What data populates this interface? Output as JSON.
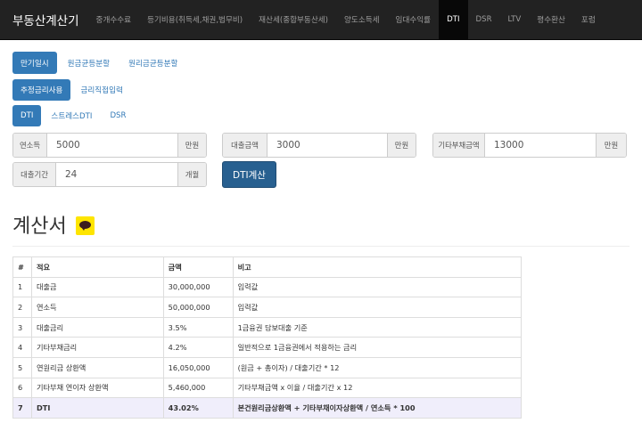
{
  "navbar": {
    "brand": "부동산계산기",
    "items": [
      {
        "label": "중개수수료",
        "active": false
      },
      {
        "label": "등기비용(취득세,채권,법무비)",
        "active": false
      },
      {
        "label": "재산세(종합부동산세)",
        "active": false
      },
      {
        "label": "양도소득세",
        "active": false
      },
      {
        "label": "임대수익률",
        "active": false
      },
      {
        "label": "DTI",
        "active": true
      },
      {
        "label": "DSR",
        "active": false
      },
      {
        "label": "LTV",
        "active": false
      },
      {
        "label": "평수환산",
        "active": false
      },
      {
        "label": "포럼",
        "active": false
      }
    ]
  },
  "repayment_tabs": [
    "만기일시",
    "원금균등분할",
    "원리금균등분할"
  ],
  "rate_tabs": [
    "추정금리사용",
    "금리직접입력"
  ],
  "dti_tabs": [
    "DTI",
    "스트레스DTI",
    "DSR"
  ],
  "form": {
    "annual_income": {
      "label": "연소득",
      "value": "5000",
      "unit": "만원"
    },
    "loan_amount": {
      "label": "대출금액",
      "value": "3000",
      "unit": "만원"
    },
    "other_debt": {
      "label": "기타부채금액",
      "value": "13000",
      "unit": "만원"
    },
    "loan_period": {
      "label": "대출기간",
      "value": "24",
      "unit": "개월"
    },
    "calculate_label": "DTI계산"
  },
  "statement_title": "계산서",
  "table": {
    "headers": [
      "#",
      "적요",
      "금액",
      "비고"
    ],
    "rows": [
      [
        "1",
        "대출금",
        "30,000,000",
        "입력값"
      ],
      [
        "2",
        "연소득",
        "50,000,000",
        "입력값"
      ],
      [
        "3",
        "대출금리",
        "3.5%",
        "1금융권 담보대출 기준"
      ],
      [
        "4",
        "기타부채금리",
        "4.2%",
        "일반적으로 1금융권에서 적용하는 금리"
      ],
      [
        "5",
        "연원리금 상환액",
        "16,050,000",
        "(원금 + 총이자) / 대출기간 * 12"
      ],
      [
        "6",
        "기타부채 연이자 상환액",
        "5,460,000",
        "기타부채금액 x 이율 / 대출기간 x 12"
      ],
      [
        "7",
        "DTI",
        "43.02%",
        "본건원리금상환액 + 기타부채이자상환액 / 연소득 * 100"
      ]
    ]
  },
  "colors": {
    "navbar_bg": "#222222",
    "accent": "#337ab7",
    "button": "#286090",
    "highlight_row": "#f0eefb",
    "kakao": "#fee500"
  }
}
